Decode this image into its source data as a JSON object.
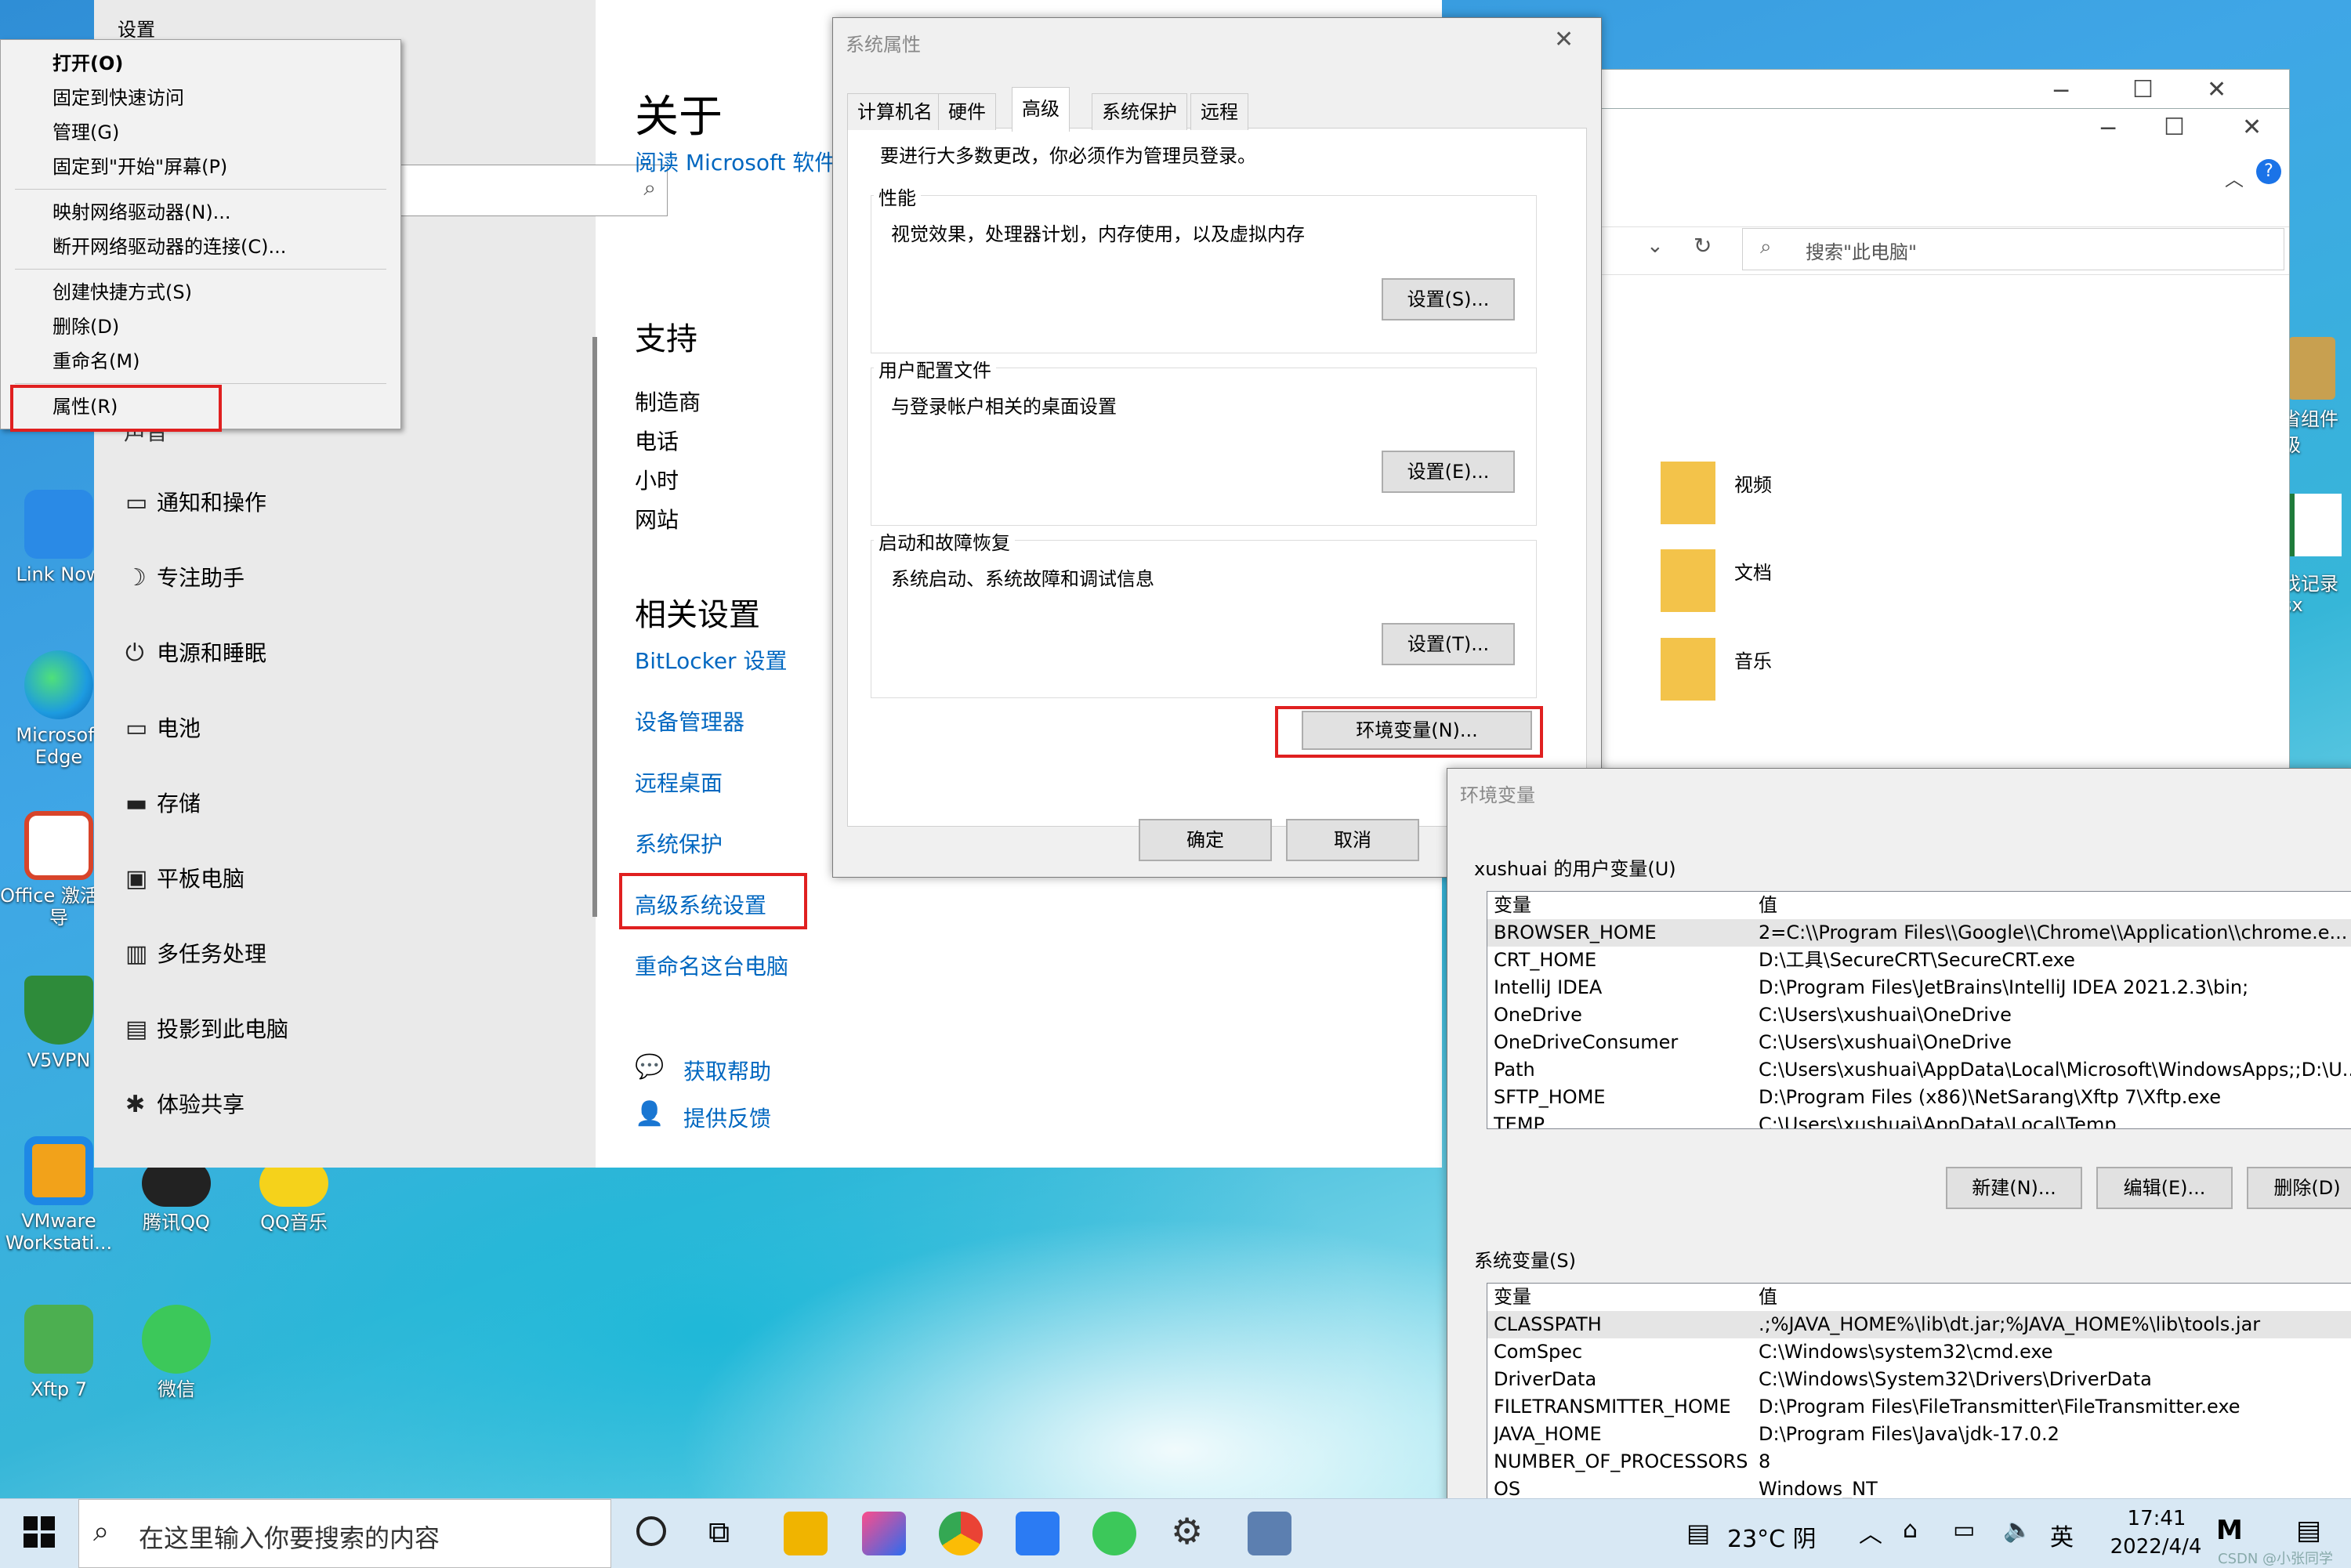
{
  "settings": {
    "window_title": "设置",
    "nav_items": [
      {
        "icon": "chat-icon",
        "label": "通知和操作"
      },
      {
        "icon": "moon-icon",
        "label": "专注助手"
      },
      {
        "icon": "power-icon",
        "label": "电源和睡眠"
      },
      {
        "icon": "battery-icon",
        "label": "电池"
      },
      {
        "icon": "storage-icon",
        "label": "存储"
      },
      {
        "icon": "tablet-icon",
        "label": "平板电脑"
      },
      {
        "icon": "multitask-icon",
        "label": "多任务处理"
      },
      {
        "icon": "project-icon",
        "label": "投影到此电脑"
      },
      {
        "icon": "share-icon",
        "label": "体验共享"
      }
    ],
    "partial_nav_label": "声音",
    "about_heading": "关于",
    "read_ms_link": "阅读 Microsoft 软件",
    "support_heading": "支持",
    "support_items": [
      "制造商",
      "电话",
      "小时",
      "网站"
    ],
    "related_heading": "相关设置",
    "related_links": [
      "BitLocker 设置",
      "设备管理器",
      "远程桌面",
      "系统保护",
      "高级系统设置",
      "重命名这台电脑"
    ],
    "help_links": [
      "获取帮助",
      "提供反馈"
    ]
  },
  "context_menu": {
    "items": [
      {
        "label": "打开(O)",
        "bold": true
      },
      {
        "label": "固定到快速访问"
      },
      {
        "label": "管理(G)"
      },
      {
        "label": "固定到\"开始\"屏幕(P)"
      },
      {
        "label": "映射网络驱动器(N)..."
      },
      {
        "label": "断开网络驱动器的连接(C)..."
      },
      {
        "label": "创建快捷方式(S)"
      },
      {
        "label": "删除(D)"
      },
      {
        "label": "重命名(M)"
      },
      {
        "label": "属性(R)"
      }
    ]
  },
  "sys_props": {
    "title": "系统属性",
    "tabs": [
      "计算机名",
      "硬件",
      "高级",
      "系统保护",
      "远程"
    ],
    "active_tab": "高级",
    "admin_note": "要进行大多数更改，你必须作为管理员登录。",
    "groups": [
      {
        "title": "性能",
        "desc": "视觉效果，处理器计划，内存使用，以及虚拟内存",
        "button": "设置(S)..."
      },
      {
        "title": "用户配置文件",
        "desc": "与登录帐户相关的桌面设置",
        "button": "设置(E)..."
      },
      {
        "title": "启动和故障恢复",
        "desc": "系统启动、系统故障和调试信息",
        "button": "设置(T)..."
      }
    ],
    "env_button": "环境变量(N)...",
    "ok": "确定",
    "cancel": "取消"
  },
  "explorer": {
    "search_placeholder": "搜索\"此电脑\"",
    "folders": [
      "视频",
      "文档",
      "音乐"
    ]
  },
  "env_vars": {
    "title": "环境变量",
    "user_section": "xushuai 的用户变量(U)",
    "col_var": "变量",
    "col_val": "值",
    "user_rows": [
      {
        "var": "BROWSER_HOME",
        "val": "2=C:\\\\Program Files\\\\Google\\\\Chrome\\\\Application\\\\chrome.e..."
      },
      {
        "var": "CRT_HOME",
        "val": "D:\\工具\\SecureCRT\\SecureCRT.exe"
      },
      {
        "var": "IntelliJ IDEA",
        "val": "D:\\Program Files\\JetBrains\\IntelliJ IDEA 2021.2.3\\bin;"
      },
      {
        "var": "OneDrive",
        "val": "C:\\Users\\xushuai\\OneDrive"
      },
      {
        "var": "OneDriveConsumer",
        "val": "C:\\Users\\xushuai\\OneDrive"
      },
      {
        "var": "Path",
        "val": "C:\\Users\\xushuai\\AppData\\Local\\Microsoft\\WindowsApps;;D:\\U..."
      },
      {
        "var": "SFTP_HOME",
        "val": "D:\\Program Files (x86)\\NetSarang\\Xftp 7\\Xftp.exe"
      },
      {
        "var": "TEMP",
        "val": "C:\\Users\\xushuai\\AppData\\Local\\Temp"
      }
    ],
    "user_buttons": [
      "新建(N)...",
      "编辑(E)...",
      "删除(D)"
    ],
    "sys_section": "系统变量(S)",
    "sys_rows": [
      {
        "var": "CLASSPATH",
        "val": ".;%JAVA_HOME%\\lib\\dt.jar;%JAVA_HOME%\\lib\\tools.jar"
      },
      {
        "var": "ComSpec",
        "val": "C:\\Windows\\system32\\cmd.exe"
      },
      {
        "var": "DriverData",
        "val": "C:\\Windows\\System32\\Drivers\\DriverData"
      },
      {
        "var": "FILETRANSMITTER_HOME",
        "val": "D:\\Program Files\\FileTransmitter\\FileTransmitter.exe"
      },
      {
        "var": "JAVA_HOME",
        "val": "D:\\Program Files\\Java\\jdk-17.0.2"
      },
      {
        "var": "NUMBER_OF_PROCESSORS",
        "val": "8"
      },
      {
        "var": "OS",
        "val": "Windows_NT"
      }
    ]
  },
  "desktop_icons": [
    {
      "label": "Link Now",
      "color": "#2a8ae6"
    },
    {
      "label": "Microsoft Edge",
      "color": "#1d9be0"
    },
    {
      "label": "Office 激活指导",
      "color": "#d8442a"
    },
    {
      "label": "V5VPN",
      "color": "#2e8b3a"
    },
    {
      "label": "VMware Workstati...",
      "color": "#f2a21a"
    },
    {
      "label": "腾讯QQ",
      "color": "#222222"
    },
    {
      "label": "QQ音乐",
      "color": "#f5d21b"
    },
    {
      "label": "Xftp 7",
      "color": "#4caf50"
    },
    {
      "label": "微信",
      "color": "#3cc85a"
    }
  ],
  "right_edge_labels": [
    "省组件",
    "级",
    "找记录",
    "sx"
  ],
  "taskbar": {
    "search_placeholder": "在这里输入你要搜索的内容",
    "weather": "23°C 阴",
    "ime": "英",
    "time": "17:41",
    "date": "2022/4/4",
    "watermark": "CSDN @小张同学",
    "apps": [
      "task-view-icon",
      "widgets-icon",
      "file-explorer-icon",
      "intellij-icon",
      "chrome-icon",
      "notes-icon",
      "wechat-icon",
      "settings-icon",
      "remote-icon"
    ]
  },
  "colors": {
    "accent": "#0067c0",
    "highlight_red": "#e02020"
  }
}
